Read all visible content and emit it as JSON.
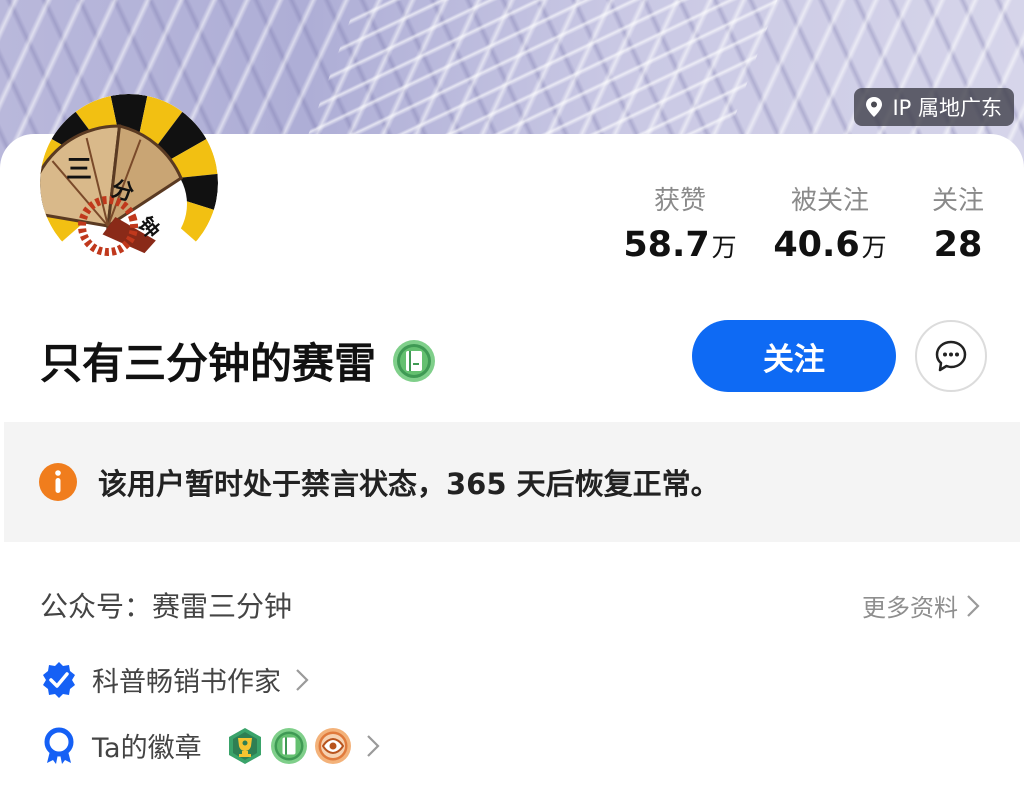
{
  "header": {
    "ip_location": "IP 属地广东"
  },
  "profile": {
    "avatar_text": "三分钟",
    "name": "只有三分钟的赛雷",
    "follow_label": "关注"
  },
  "stats": {
    "likes": {
      "label": "获赞",
      "value": "58.7",
      "unit": "万"
    },
    "followers": {
      "label": "被关注",
      "value": "40.6",
      "unit": "万"
    },
    "following": {
      "label": "关注",
      "value": "28"
    }
  },
  "notice": {
    "text": "该用户暂时处于禁言状态，365 天后恢复正常。"
  },
  "details": {
    "official_account": "公众号：赛雷三分钟",
    "more_label": "更多资料",
    "certification": "科普畅销书作家",
    "badges_label": "Ta的徽章"
  },
  "colors": {
    "accent": "#0e6af4",
    "notice_icon": "#f07d1d",
    "verified": "#1560f5"
  },
  "icons": {
    "location": "location-pin-icon",
    "message": "chat-bubble-icon",
    "info": "info-icon",
    "verified": "verified-check-icon",
    "badge": "ribbon-badge-icon",
    "chevron": "chevron-right-icon"
  }
}
